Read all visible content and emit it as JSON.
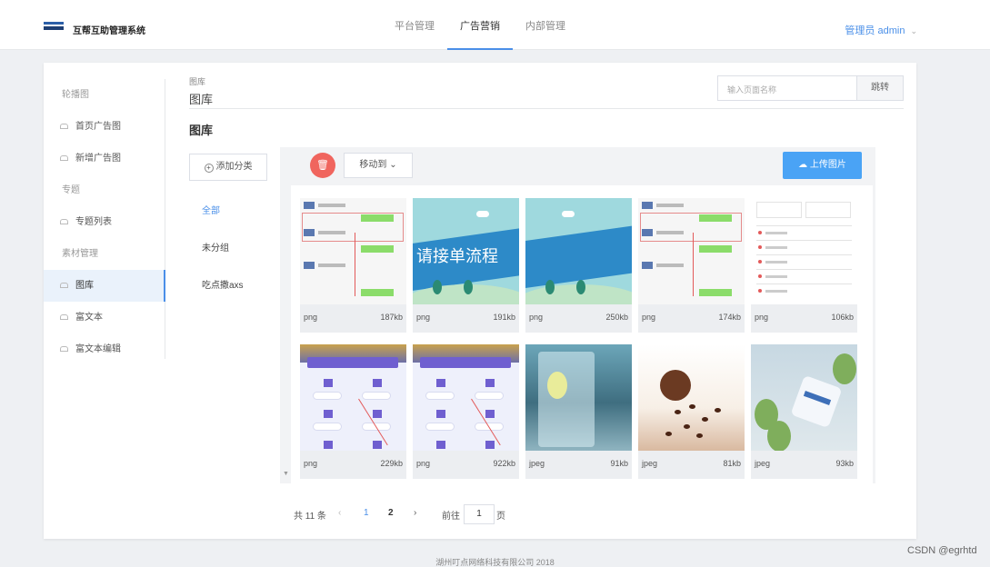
{
  "header": {
    "app_title": "互帮互助管理系统",
    "tabs": [
      {
        "label": "平台管理"
      },
      {
        "label": "广告营销",
        "active": true
      },
      {
        "label": "内部管理"
      }
    ],
    "user": "管理员 admin"
  },
  "sidebar": {
    "items": [
      {
        "label": "轮播图",
        "type": "group"
      },
      {
        "label": "首页广告图",
        "type": "item"
      },
      {
        "label": "新增广告图",
        "type": "item"
      },
      {
        "label": "专题",
        "type": "group"
      },
      {
        "label": "专题列表",
        "type": "item"
      },
      {
        "label": "素材管理",
        "type": "group"
      },
      {
        "label": "图库",
        "type": "item",
        "active": true
      },
      {
        "label": "富文本",
        "type": "item"
      },
      {
        "label": "富文本编辑",
        "type": "item"
      }
    ]
  },
  "breadcrumb": {
    "small": "图库",
    "title": "图库"
  },
  "search": {
    "placeholder": "输入页面名称",
    "button": "跳转"
  },
  "section_title": "图库",
  "categories": {
    "add_label": "添加分类",
    "items": [
      {
        "label": "全部",
        "active": true
      },
      {
        "label": "未分组"
      },
      {
        "label": "吃点撒axs"
      }
    ]
  },
  "toolbar": {
    "delete_icon": "trash-icon",
    "move_label": "移动到",
    "upload_label": "上传图片"
  },
  "images": [
    {
      "ext": "png",
      "size": "187kb",
      "kind": "chat"
    },
    {
      "ext": "png",
      "size": "191kb",
      "kind": "banner",
      "caption": "请接单流程"
    },
    {
      "ext": "png",
      "size": "250kb",
      "kind": "banner"
    },
    {
      "ext": "png",
      "size": "174kb",
      "kind": "chat"
    },
    {
      "ext": "png",
      "size": "106kb",
      "kind": "menu"
    },
    {
      "ext": "png",
      "size": "229kb",
      "kind": "app"
    },
    {
      "ext": "png",
      "size": "922kb",
      "kind": "app"
    },
    {
      "ext": "jpeg",
      "size": "91kb",
      "kind": "glass"
    },
    {
      "ext": "jpeg",
      "size": "81kb",
      "kind": "coffee"
    },
    {
      "ext": "jpeg",
      "size": "93kb",
      "kind": "tea"
    }
  ],
  "pagination": {
    "total": "共 11 条",
    "pages": [
      "1",
      "2"
    ],
    "current": "1",
    "goto_label": "前往",
    "goto_value": "1",
    "page_unit": "页"
  },
  "footer": "湖州叮点网络科技有限公司 2018",
  "watermark": "CSDN @egrhtd",
  "colors": {
    "accent": "#4a8fe8",
    "upload": "#4aa3f5",
    "delete": "#f0655e"
  }
}
